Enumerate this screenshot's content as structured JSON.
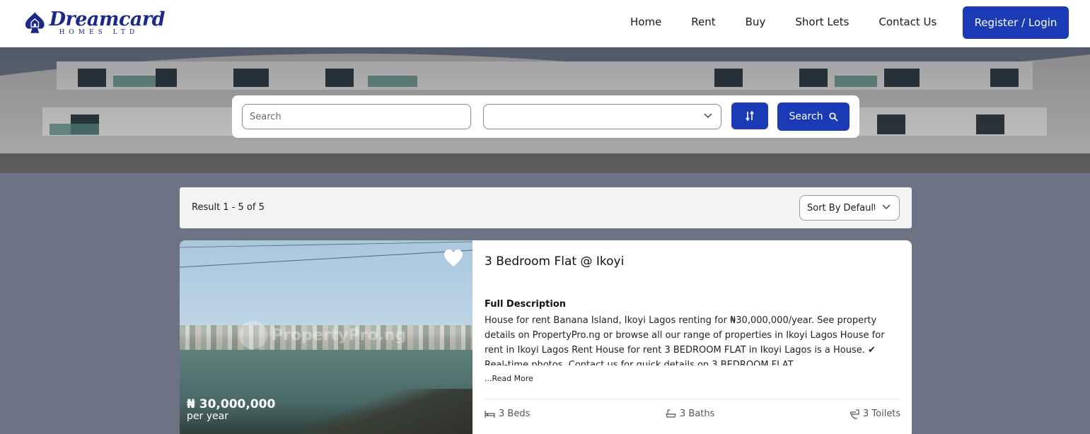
{
  "header": {
    "logo_main": "Dreamcard",
    "logo_sub": "HOMES LTD",
    "nav": [
      {
        "label": "Home"
      },
      {
        "label": "Rent"
      },
      {
        "label": "Buy"
      },
      {
        "label": "Short Lets"
      },
      {
        "label": "Contact Us"
      }
    ],
    "auth_label": "Register / Login"
  },
  "search": {
    "placeholder": "Search",
    "location_value": "",
    "button_label": "Search"
  },
  "results": {
    "count_text": "Result 1 - 5 of 5",
    "sort_label": "Sort By Default"
  },
  "listing": {
    "title": "3 Bedroom Flat @ Ikoyi",
    "price": "₦ 30,000,000",
    "period": "per year",
    "watermark": "PropertyPro.ng",
    "description_heading": "Full Description",
    "description": "House for rent Banana Island, Ikoyi Lagos renting for ₦30,000,000/year. See property details on PropertyPro.ng or browse all our range of properties in Ikoyi Lagos House for rent in Ikoyi Lagos Rent House for rent 3 BEDROOM FLAT in Ikoyi Lagos is a House. ✔ Real-time photos. Contact us for quick details on 3 BEDROOM FLAT",
    "read_more": "...Read More",
    "beds": "3 Beds",
    "baths": "3 Baths",
    "toilets": "3 Toilets"
  },
  "colors": {
    "brand": "#1b2a8a",
    "accent": "#1a3bb5",
    "page_bg": "#6b7385"
  }
}
